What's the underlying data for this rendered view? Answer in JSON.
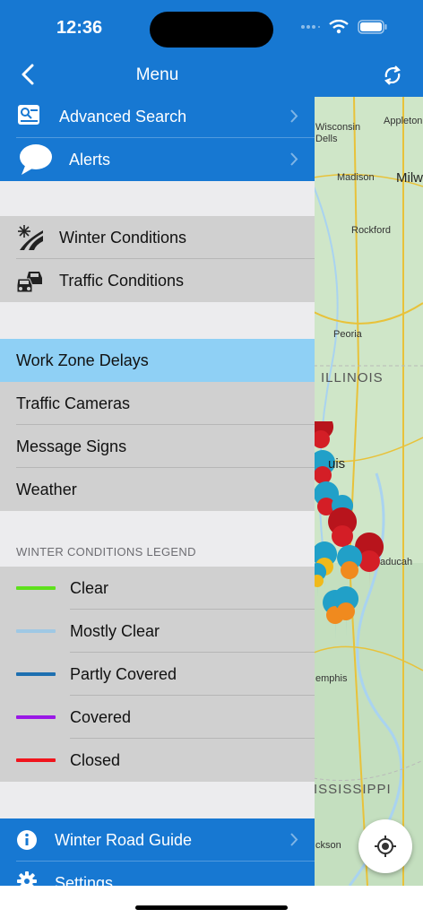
{
  "status_bar": {
    "time": "12:36"
  },
  "nav": {
    "title": "Menu"
  },
  "menu": {
    "top_items": [
      {
        "label": "Advanced Search",
        "icon": "advanced-search-icon"
      },
      {
        "label": "Alerts",
        "icon": "alerts-speech-bubble-icon"
      }
    ],
    "condition_items": [
      {
        "label": "Winter Conditions",
        "icon": "snow-road-icon"
      },
      {
        "label": "Traffic Conditions",
        "icon": "cars-icon"
      }
    ],
    "layer_items": [
      {
        "label": "Work Zone Delays",
        "selected": true
      },
      {
        "label": "Traffic Cameras",
        "selected": false
      },
      {
        "label": "Message Signs",
        "selected": false
      },
      {
        "label": "Weather",
        "selected": false
      }
    ],
    "legend_header": "WINTER CONDITIONS LEGEND",
    "legend": [
      {
        "label": "Clear",
        "color": "#5ee01c"
      },
      {
        "label": "Mostly Clear",
        "color": "#9fc8e4"
      },
      {
        "label": "Partly Covered",
        "color": "#1d6fb0"
      },
      {
        "label": "Covered",
        "color": "#9a18e6"
      },
      {
        "label": "Closed",
        "color": "#f0151d"
      }
    ],
    "bottom_items": [
      {
        "label": "Winter Road Guide",
        "icon": "info-icon"
      },
      {
        "label": "Settings",
        "icon": "gear-icon"
      }
    ]
  },
  "map": {
    "labels": {
      "appleton": "Appleton",
      "wisconsin_dells": "Wisconsin\nDells",
      "madison": "Madison",
      "milwaukee": "Milw",
      "rockford": "Rockford",
      "peoria": "Peoria",
      "illinois": "ILLINOIS",
      "st_louis": "uis",
      "paducah": "aducah",
      "memphis": "emphis",
      "mississippi": "ISSISSIPPI",
      "jackson": "ckson"
    }
  },
  "colors": {
    "brand_blue": "#1778d2",
    "highlight": "#8fd0f5",
    "panel_gray": "#d0d0d0"
  }
}
